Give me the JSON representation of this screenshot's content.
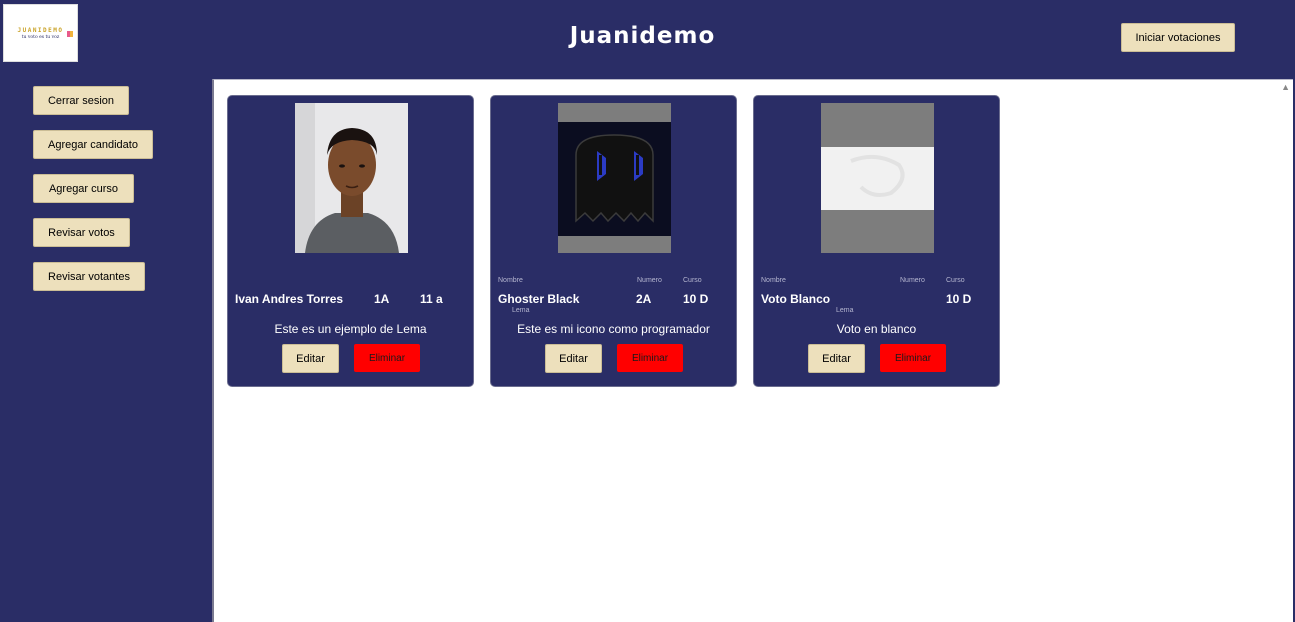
{
  "header": {
    "logo_word": "JUANIDEMO",
    "logo_tagline": "tu voto es tu voz",
    "title": "Juanidemo",
    "start_label": "Iniciar votaciones"
  },
  "sidebar": {
    "items": [
      {
        "label": "Cerrar sesion"
      },
      {
        "label": "Agregar candidato"
      },
      {
        "label": "Agregar curso"
      },
      {
        "label": "Revisar votos"
      },
      {
        "label": "Revisar votantes"
      }
    ]
  },
  "labels": {
    "nombre": "Nombre",
    "numero": "Numero",
    "curso": "Curso",
    "lema": "Lema"
  },
  "cards": [
    {
      "nombre": "Ivan Andres Torres",
      "numero": "1A",
      "curso": "11 a",
      "lema": "Este es un ejemplo de Lema",
      "edit": "Editar",
      "delete": "Eliminar"
    },
    {
      "nombre": "Ghoster Black",
      "numero": "2A",
      "curso": "10 D",
      "lema": "Este es mi icono como programador",
      "edit": "Editar",
      "delete": "Eliminar"
    },
    {
      "nombre": "Voto Blanco",
      "numero": "",
      "curso": "10 D",
      "lema": "Voto en blanco",
      "edit": "Editar",
      "delete": "Eliminar"
    }
  ],
  "colors": {
    "brand": "#2a2d66",
    "button": "#ede0bc",
    "danger": "#ff0000"
  }
}
